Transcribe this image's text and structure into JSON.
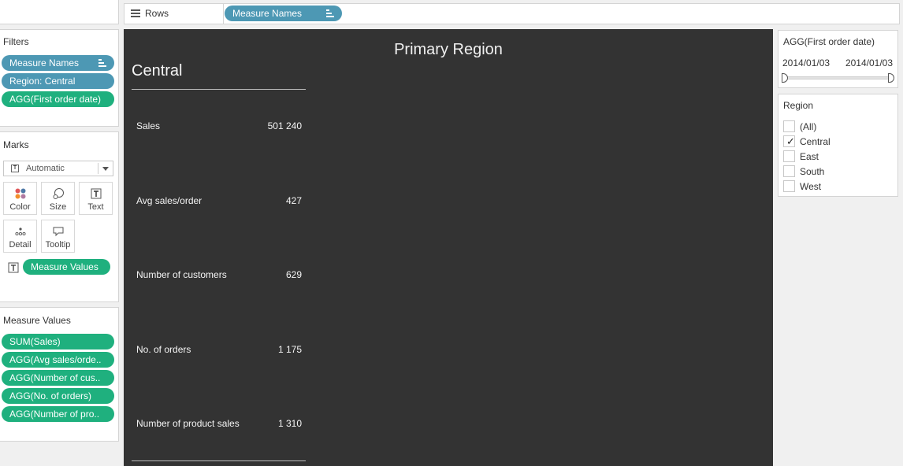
{
  "rows_shelf": {
    "label": "Rows",
    "pill": "Measure Names"
  },
  "filters": {
    "title": "Filters",
    "pills": [
      "Measure Names",
      "Region: Central",
      "AGG(First order date)"
    ]
  },
  "marks": {
    "title": "Marks",
    "mark_type": "Automatic",
    "buttons": {
      "color": "Color",
      "size": "Size",
      "text": "Text",
      "detail": "Detail",
      "tooltip": "Tooltip"
    },
    "text_pill": "Measure Values"
  },
  "measure_values": {
    "title": "Measure Values",
    "pills": [
      "SUM(Sales)",
      "AGG(Avg sales/orde..",
      "AGG(Number of cus..",
      "AGG(No. of orders)",
      "AGG(Number of pro.."
    ]
  },
  "viz": {
    "title": "Primary Region",
    "region": "Central",
    "metrics": [
      {
        "label": "Sales",
        "value": "501 240"
      },
      {
        "label": "Avg sales/order",
        "value": "427"
      },
      {
        "label": "Number of customers",
        "value": "629"
      },
      {
        "label": "No. of orders",
        "value": "1 175"
      },
      {
        "label": "Number of product sales",
        "value": "1 310"
      }
    ]
  },
  "date_filter": {
    "title": "AGG(First order date)",
    "start": "2014/01/03",
    "end": "2014/01/03"
  },
  "region_filter": {
    "title": "Region",
    "options": [
      {
        "label": "(All)",
        "checked": false
      },
      {
        "label": "Central",
        "checked": true
      },
      {
        "label": "East",
        "checked": false
      },
      {
        "label": "South",
        "checked": false
      },
      {
        "label": "West",
        "checked": false
      }
    ]
  },
  "colors": {
    "dimension_pill": "#4d98b4",
    "measure_pill": "#1fb07e",
    "canvas_bg": "#333333"
  }
}
